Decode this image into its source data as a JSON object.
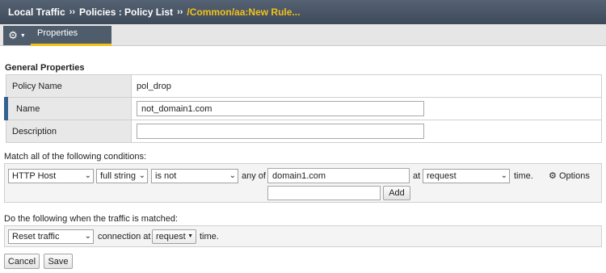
{
  "breadcrumb": {
    "items": [
      "Local Traffic",
      "Policies : Policy List"
    ],
    "separator": "››",
    "current": "/Common/aa:New Rule..."
  },
  "toolbar": {
    "tab_label": "Properties"
  },
  "general": {
    "title": "General Properties",
    "policy_name_label": "Policy Name",
    "policy_name_value": "pol_drop",
    "name_label": "Name",
    "name_value": "not_domain1.com",
    "description_label": "Description",
    "description_value": ""
  },
  "conditions": {
    "title": "Match all of the following conditions:",
    "operand": "HTTP Host",
    "match_type": "full string",
    "operator": "is not",
    "any_of_label": "any of",
    "value": "domain1.com",
    "at_label": "at",
    "event": "request",
    "time_label": "time.",
    "options_label": "Options",
    "add_value": "",
    "add_label": "Add"
  },
  "actions": {
    "title": "Do the following when the traffic is matched:",
    "action": "Reset traffic",
    "connection_label": "connection at",
    "event": "request",
    "time_label": "time."
  },
  "buttons": {
    "cancel": "Cancel",
    "save": "Save"
  },
  "colors": {
    "header_bg": "#46525f",
    "accent": "#f3c11a",
    "active_marker": "#33628f"
  }
}
